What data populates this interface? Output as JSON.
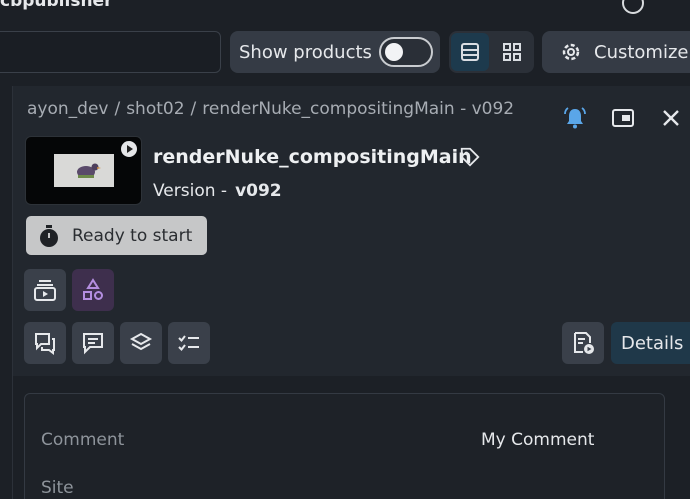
{
  "top_bar": {
    "app_title": "cbpublisher",
    "show_products_label": "Show products",
    "show_products_on": false,
    "customize_label": "Customize"
  },
  "panel": {
    "breadcrumb": [
      "ayon_dev",
      "shot02",
      "renderNuke_compositingMain - v092"
    ],
    "title": "renderNuke_compositingMain",
    "version_label": "Version -",
    "version_value": "v092",
    "status_label": "Ready to start",
    "details_label": "Details"
  },
  "attributes": [
    {
      "key": "Comment",
      "value": "My Comment"
    },
    {
      "key": "Site",
      "value": ""
    }
  ],
  "colors": {
    "accent_bell": "#5aa6e8",
    "status_bg": "#c6c7c8",
    "details_bg": "#1f3849",
    "purple_btn": "#3e2f4d"
  }
}
